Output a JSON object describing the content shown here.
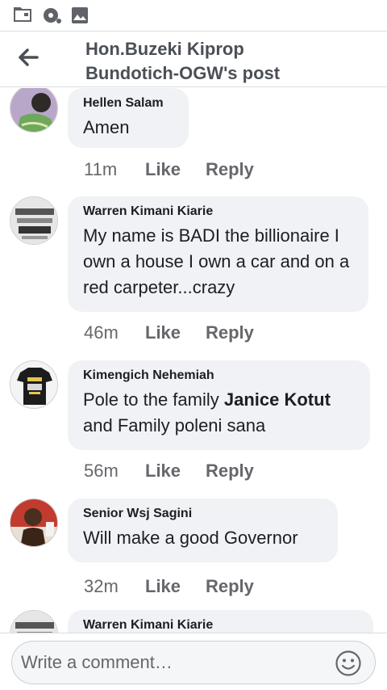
{
  "header": {
    "title_line1": "Hon.Buzeki Kiprop",
    "title_line2": "Bundotich-OGW's post"
  },
  "status_icons": [
    "folder-icon",
    "media-icon",
    "image-icon"
  ],
  "actions": {
    "like": "Like",
    "reply": "Reply"
  },
  "comments": [
    {
      "author": "Hellen Salam",
      "text": "Amen",
      "time": "11m"
    },
    {
      "author": "Warren Kimani Kiarie",
      "text": "My name is BADI the billionaire I own a house I own a car and on a red carpeter...crazy",
      "time": "46m"
    },
    {
      "author": "Kimengich Nehemiah",
      "text_before": "Pole to the family",
      "mention": "Janice Kotut",
      "text_after": "and Family poleni sana",
      "time": "56m"
    },
    {
      "author": "Senior Wsj Sagini",
      "text": "Will make a good Governor",
      "time": "32m"
    },
    {
      "author": "Warren Kimani Kiarie"
    }
  ],
  "composer": {
    "placeholder": "Write a comment…"
  },
  "colors": {
    "bubble": "#f0f2f5",
    "meta": "#65676b",
    "title": "#4b4f56"
  }
}
